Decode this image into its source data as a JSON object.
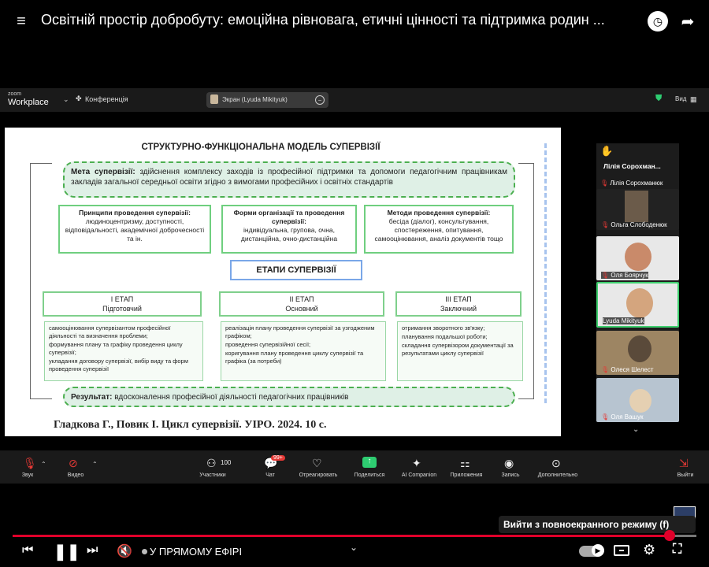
{
  "youtube": {
    "title": "Освітній простір добробуту: емоційна рівновага, етичні цінності та підтримка родин ...",
    "live_label": "У ПРЯМОМУ ЕФІРІ",
    "tooltip": "Вийти з повноекранного режиму (f)"
  },
  "zoom_header": {
    "logo_line1": "zoom",
    "logo_line2": "Workplace",
    "conference_label": "Конференція",
    "screen_label": "Экран (Lyuda Mikityuk)",
    "view_label": "Вид"
  },
  "slide": {
    "title": "СТРУКТУРНО-ФУНКЦІОНАЛЬНА МОДЕЛЬ СУПЕРВІЗІЇ",
    "goal_label": "Мета супервізії:",
    "goal_text": "здійснення комплексу заходів із професійної підтримки та допомоги педагогічним працівникам закладів загальної середньої освіти згідно з вимогами професійних і освітніх стандартів",
    "principles_title": "Принципи проведення супервізії:",
    "principles_text": "людиноцентризму, доступності, відповідальності, академічної доброчесності та ін.",
    "forms_title": "Форми організації та проведення супервізії:",
    "forms_text": "індивідуальна, групова, очна, дистанційна, очно-дистанційна",
    "methods_title": "Методи проведення супервізії:",
    "methods_text": "бесіда (діалог), консультування, спостереження, опитування, самооцінювання, аналіз документів тощо",
    "stages_label": "ЕТАПИ СУПЕРВІЗІЇ",
    "stage1": "І ЕТАП\nПідготовчий",
    "stage2": "ІІ ЕТАП\nОсновний",
    "stage3": "ІІІ ЕТАП\nЗаключний",
    "stage1_items": [
      "самооцінювання супервізантом професійної діяльності та визначення проблеми;",
      "формування плану та графіку проведення циклу супервізії;",
      "укладання договору супервізії, вибір виду та форм проведення супервізії"
    ],
    "stage2_items": [
      "реалізація плану проведення супервізії за узгодженим графіком;",
      "проведення супервізійної сесії;",
      "коригування плану проведення циклу супервізії та графіка (за потреби)"
    ],
    "stage3_items": [
      "отримання зворотного зв'язку;",
      "планування подальшої роботи;",
      "складання супервізором документації за результатами циклу супервізії"
    ],
    "result_label": "Результат:",
    "result_text": "вдосконалення професійної діяльності педагогічних працівників",
    "citation": "Гладкова Г., Повик І. Цикл супервізії. УІРО. 2024. 10 с."
  },
  "participants": {
    "host_tile": "Лілія Сорохман...",
    "names": [
      "Лілія Сорохманюк",
      "Ольга Слободенюк",
      "Оля Боярчук",
      "Lyuda Mikityuk",
      "Олеся Шелест",
      "Оля Вашук"
    ]
  },
  "zoom_toolbar": {
    "audio": "Звук",
    "video": "Видео",
    "participants": "Участники",
    "participants_count": "100",
    "chat": "Чат",
    "chat_badge": "99+",
    "react": "Отреагировать",
    "share": "Поделиться",
    "ai": "AI Companion",
    "apps": "Приложения",
    "record": "Запись",
    "more": "Дополнительно",
    "leave": "Выйти"
  },
  "colors": {
    "accent": "#e0002a",
    "green": "#4caf50"
  }
}
